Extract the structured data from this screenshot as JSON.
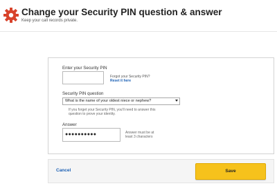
{
  "header": {
    "title": "Change your Security PIN question & answer",
    "subtitle": "Keep your call records private.",
    "icon": "gear-icon",
    "accent_color": "#d8432b"
  },
  "form": {
    "pin_label": "Enter your Security PIN",
    "pin_value": "",
    "forgot_text": "Forgot your Security PIN?",
    "reset_link": "Reset it here",
    "question_label": "Security PIN question",
    "question_selected": "What is the name of your oldest niece or nephew?",
    "help_text": "If you forget your Security PIN, you'll need to answer this question to prove your identity.",
    "answer_label": "Answer",
    "answer_value": "●●●●●●●●●●",
    "answer_hint": "Answer must be at least 3 characters"
  },
  "actions": {
    "cancel_label": "Cancel",
    "save_label": "Save",
    "save_color": "#f6c21c",
    "link_color": "#1a5fb4"
  }
}
